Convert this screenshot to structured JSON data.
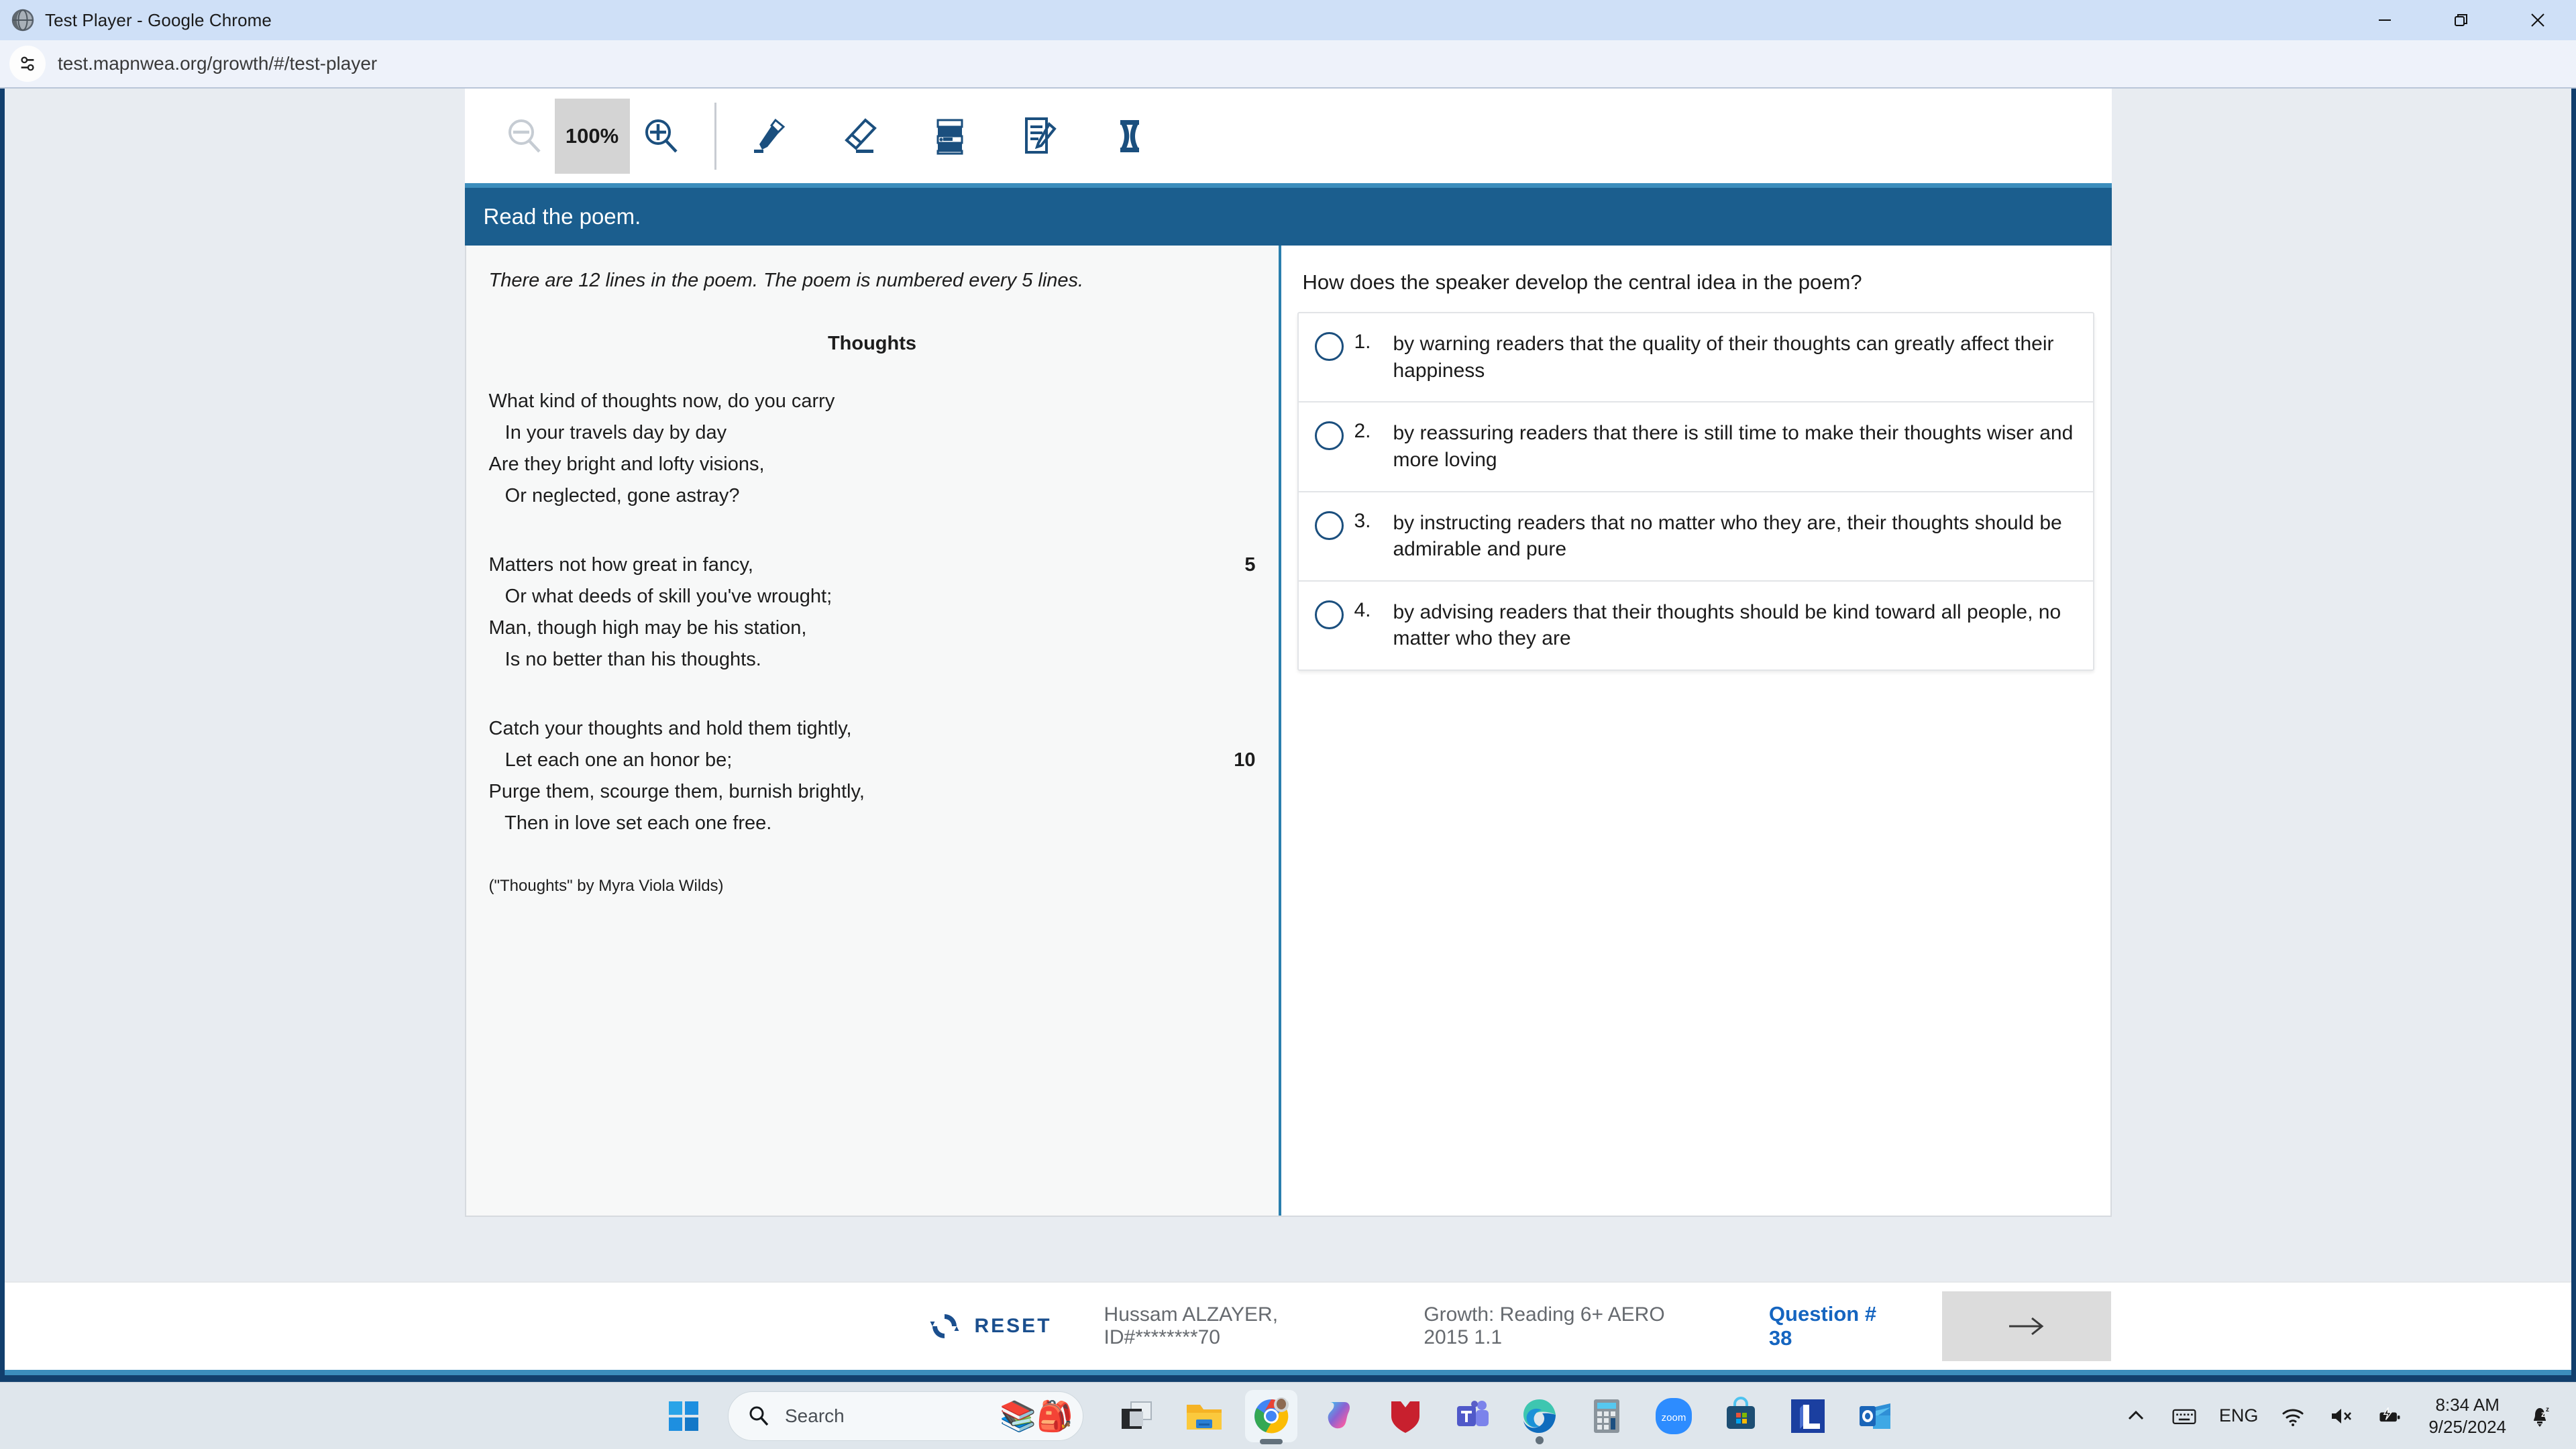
{
  "browser": {
    "window_title": "Test Player - Google Chrome",
    "favicon": "globe-icon",
    "url": "test.mapnwea.org/growth/#/test-player",
    "controls": {
      "minimize": "minimize-icon",
      "restore": "restore-icon",
      "close": "close-icon"
    }
  },
  "toolbar": {
    "zoom_out": "zoom-out-icon",
    "zoom_level": "100%",
    "zoom_in": "zoom-in-icon",
    "tools": [
      {
        "name": "highlighter-tool",
        "icon": "highlighter-icon"
      },
      {
        "name": "eraser-tool",
        "icon": "eraser-icon"
      },
      {
        "name": "line-reader-tool",
        "icon": "line-reader-icon"
      },
      {
        "name": "notepad-tool",
        "icon": "notepad-pencil-icon"
      },
      {
        "name": "cross-off-tool",
        "icon": "cross-off-icon"
      }
    ]
  },
  "stimulus": {
    "banner": "Read the poem.",
    "note": "There are 12 lines in the poem. The poem is numbered every 5 lines.",
    "poem_title": "Thoughts",
    "stanzas": [
      [
        {
          "text": "What kind of thoughts now, do you carry",
          "num": ""
        },
        {
          "text": "   In your travels day by day",
          "num": ""
        },
        {
          "text": "Are they bright and lofty visions,",
          "num": ""
        },
        {
          "text": "   Or neglected, gone astray?",
          "num": ""
        }
      ],
      [
        {
          "text": "Matters not how great in fancy,",
          "num": "5"
        },
        {
          "text": "   Or what deeds of skill you've wrought;",
          "num": ""
        },
        {
          "text": "Man, though high may be his station,",
          "num": ""
        },
        {
          "text": "   Is no better than his thoughts.",
          "num": ""
        }
      ],
      [
        {
          "text": "Catch your thoughts and hold them tightly,",
          "num": ""
        },
        {
          "text": "   Let each one an honor be;",
          "num": "10"
        },
        {
          "text": "Purge them, scourge them, burnish brightly,",
          "num": ""
        },
        {
          "text": "   Then in love set each one free.",
          "num": ""
        }
      ]
    ],
    "attribution": "(\"Thoughts\" by Myra Viola Wilds)"
  },
  "question": {
    "stem": "How does the speaker develop the central idea in the poem?",
    "choices": [
      {
        "number": "1.",
        "text": "by warning readers that the quality of their thoughts can greatly affect their happiness",
        "selected": false
      },
      {
        "number": "2.",
        "text": "by reassuring readers that there is still time to make their thoughts wiser and more loving",
        "selected": false
      },
      {
        "number": "3.",
        "text": "by instructing readers that no matter who they are, their thoughts should be admirable and pure",
        "selected": false
      },
      {
        "number": "4.",
        "text": "by advising readers that their thoughts should be kind toward all people, no matter who they are",
        "selected": false
      }
    ]
  },
  "footer": {
    "reset_label": "RESET",
    "reset_icon": "refresh-icon",
    "student": "Hussam ALZAYER, ID#********70",
    "test_name": "Growth: Reading 6+ AERO 2015 1.1",
    "question_number": "Question # 38",
    "next_icon": "arrow-right-icon"
  },
  "taskbar": {
    "start_icon": "windows-start-icon",
    "search": {
      "icon": "search-icon",
      "placeholder": "Search",
      "emoji": "school-supplies-icon"
    },
    "apps": [
      {
        "name": "task-view",
        "icon": "task-view-icon",
        "running": false,
        "active": false
      },
      {
        "name": "file-explorer",
        "icon": "folder-icon",
        "running": false,
        "active": false
      },
      {
        "name": "google-chrome",
        "icon": "chrome-icon",
        "running": true,
        "active": true
      },
      {
        "name": "microsoft-copilot",
        "icon": "copilot-icon",
        "running": false,
        "active": false
      },
      {
        "name": "mcafee",
        "icon": "mcafee-shield-icon",
        "running": false,
        "active": false
      },
      {
        "name": "microsoft-teams",
        "icon": "teams-icon",
        "running": false,
        "active": false
      },
      {
        "name": "microsoft-edge",
        "icon": "edge-icon",
        "running": true,
        "active": false
      },
      {
        "name": "calculator",
        "icon": "calculator-icon",
        "running": false,
        "active": false
      },
      {
        "name": "zoom",
        "icon": "zoom-app-icon",
        "running": false,
        "active": false
      },
      {
        "name": "microsoft-store",
        "icon": "store-icon",
        "running": false,
        "active": false
      },
      {
        "name": "lockdown-browser",
        "icon": "lockdown-l-icon",
        "running": false,
        "active": false
      },
      {
        "name": "outlook",
        "icon": "outlook-icon",
        "running": false,
        "active": false
      }
    ],
    "tray": {
      "overflow": "chevron-up-icon",
      "keyboard": "touch-keyboard-icon",
      "language": "ENG",
      "wifi": "wifi-icon",
      "volume": "volume-muted-icon",
      "battery": "battery-charging-icon",
      "time": "8:34 AM",
      "date": "9/25/2024",
      "notifications": "do-not-disturb-bell-icon"
    }
  },
  "colors": {
    "banner_blue": "#1b5e8e",
    "accent_blue": "#3c8dbc",
    "navy": "#123f6d",
    "link_blue": "#1565c0"
  }
}
